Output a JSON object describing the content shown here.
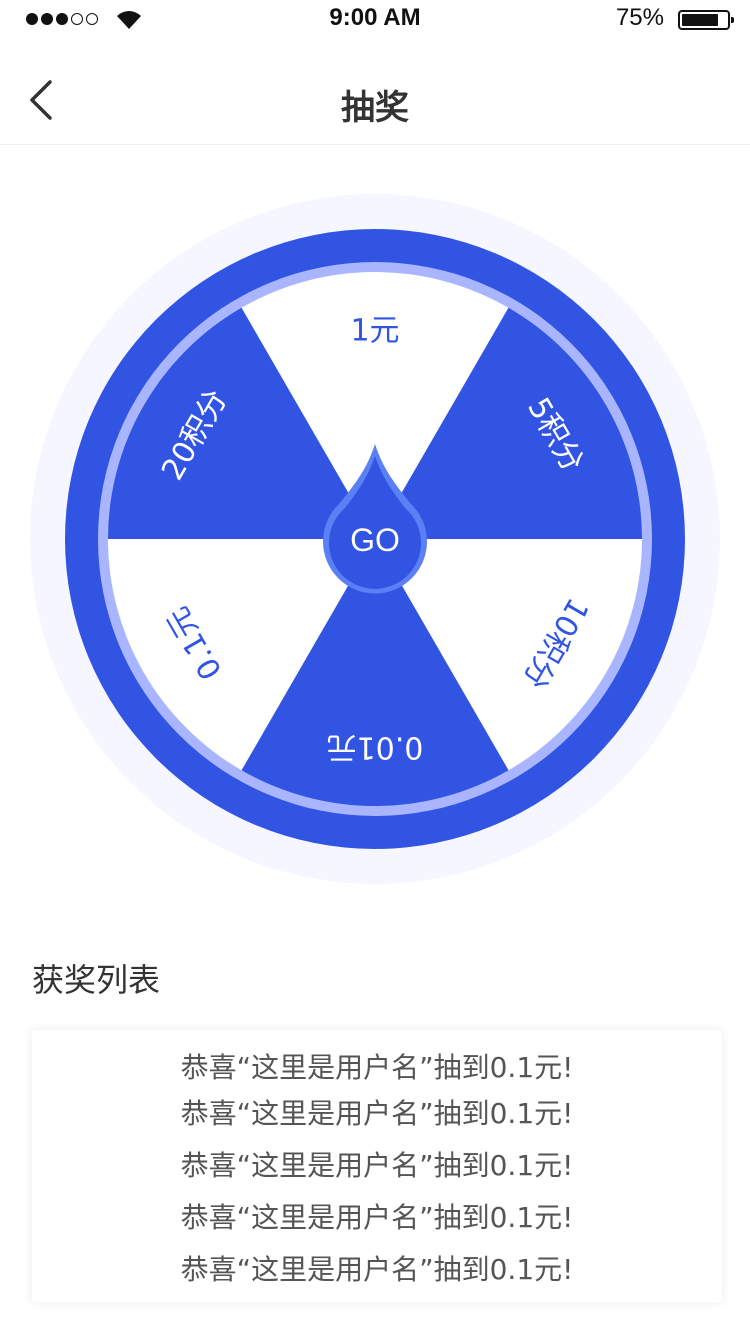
{
  "status_bar": {
    "time": "9:00 AM",
    "battery": "75%",
    "battery_level": 0.75,
    "signal_bars": 3,
    "signal_total": 5
  },
  "nav": {
    "title": "抽奖",
    "back_icon": "chevron-left-icon"
  },
  "wheel": {
    "center_label": "GO",
    "segments": [
      "1元",
      "5积分",
      "10积分",
      "0.01元",
      "0.1元",
      "20积分"
    ],
    "colors": {
      "primary": "#3154e3",
      "ring_light": "#a9b6ff",
      "halo": "#f5f6ff",
      "white": "#ffffff",
      "pointer_edge": "#5b7ff5"
    }
  },
  "winners": {
    "title": "获奖列表",
    "items": [
      "恭喜“这里是用户名”抽到0.1元!",
      "恭喜“这里是用户名”抽到0.1元!",
      "恭喜“这里是用户名”抽到0.1元!",
      "恭喜“这里是用户名”抽到0.1元!",
      "恭喜“这里是用户名”抽到0.1元!"
    ]
  }
}
